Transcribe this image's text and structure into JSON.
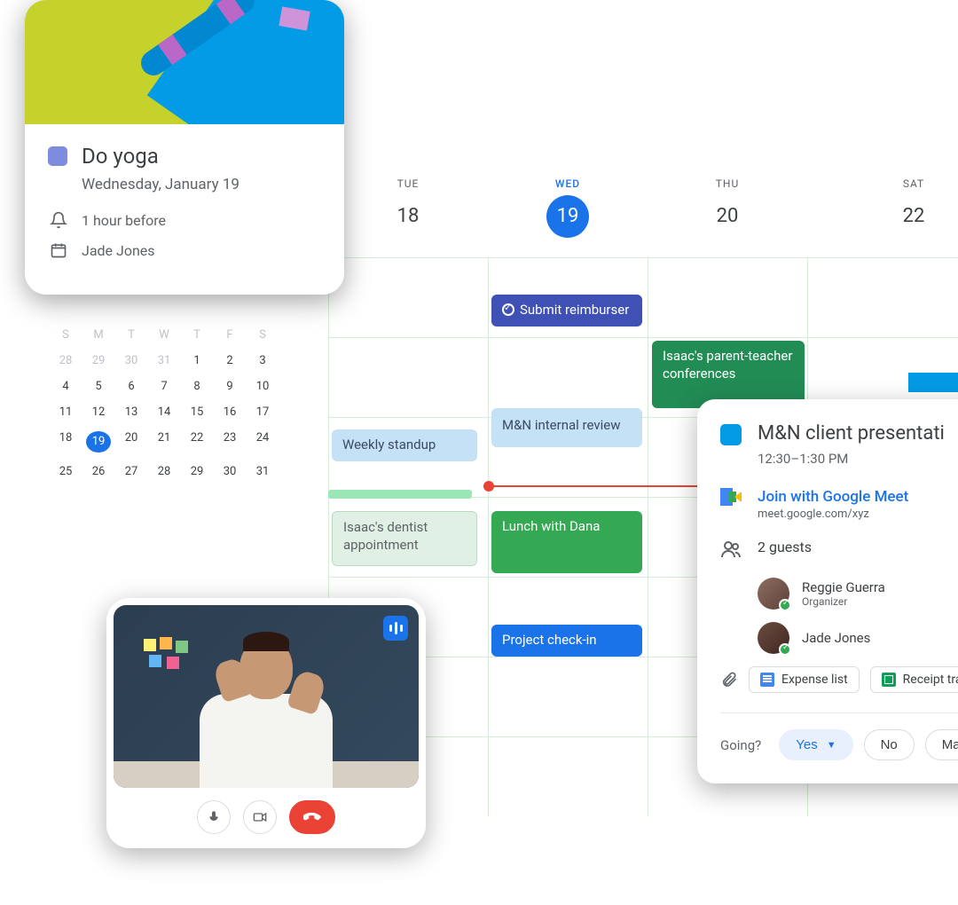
{
  "calendar": {
    "days": [
      {
        "label": "TUE",
        "num": "18",
        "today": false
      },
      {
        "label": "WED",
        "num": "19",
        "today": true
      },
      {
        "label": "THU",
        "num": "20",
        "today": false
      },
      {
        "label": "SAT",
        "num": "22",
        "today": false
      }
    ],
    "events": {
      "submit": "Submit reimburser",
      "standup": "Weekly standup",
      "mn_review": "M&N internal review",
      "parent_teacher": "Isaac's parent-teacher conferences",
      "dentist": "Isaac's dentist appointment",
      "lunch": "Lunch with Dana",
      "checkin": "Project check-in"
    }
  },
  "yoga": {
    "title": "Do yoga",
    "date": "Wednesday, January 19",
    "reminder": "1 hour before",
    "owner": "Jade Jones"
  },
  "mini_month": {
    "weekdays": [
      "S",
      "M",
      "T",
      "W",
      "T",
      "F",
      "S"
    ],
    "rows": [
      [
        "28",
        "29",
        "30",
        "31",
        "1",
        "2",
        "3"
      ],
      [
        "4",
        "5",
        "6",
        "7",
        "8",
        "9",
        "10"
      ],
      [
        "11",
        "12",
        "13",
        "14",
        "15",
        "16",
        "17"
      ],
      [
        "18",
        "19",
        "20",
        "21",
        "22",
        "23",
        "24"
      ],
      [
        "25",
        "26",
        "27",
        "28",
        "29",
        "30",
        "31"
      ]
    ],
    "today": "19"
  },
  "detail": {
    "title": "M&N client presentati",
    "time": "12:30–1:30 PM",
    "meet_label": "Join with Google Meet",
    "meet_url": "meet.google.com/xyz",
    "guests_label": "2 guests",
    "guests": [
      {
        "name": "Reggie Guerra",
        "role": "Organizer"
      },
      {
        "name": "Jade Jones",
        "role": ""
      }
    ],
    "attachments": [
      {
        "label": "Expense list"
      },
      {
        "label": "Receipt tra"
      }
    ],
    "going_label": "Going?",
    "rsvp": {
      "yes": "Yes",
      "no": "No",
      "maybe": "Ma"
    }
  }
}
